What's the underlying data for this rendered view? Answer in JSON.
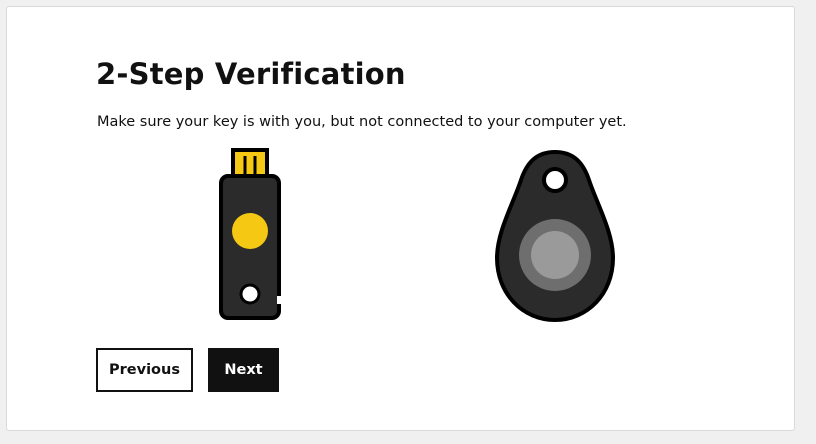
{
  "page": {
    "title": "2-Step Verification",
    "description": "Make sure your key is with you, but not connected to your computer yet."
  },
  "illustrations": {
    "usb_key_icon": "usb-security-key",
    "fob_key_icon": "nfc-security-key-fob"
  },
  "buttons": {
    "previous_label": "Previous",
    "next_label": "Next"
  },
  "colors": {
    "key_body": "#2b2b2b",
    "key_accent": "#f5c814",
    "primary_button_bg": "#111111"
  }
}
